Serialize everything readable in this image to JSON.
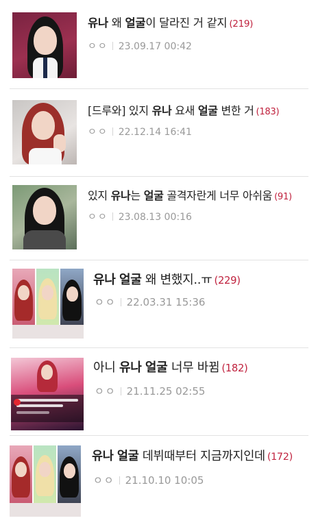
{
  "posts": [
    {
      "title_parts": [
        {
          "text": "유나",
          "bold": true
        },
        {
          "text": " 왜 ",
          "bold": false
        },
        {
          "text": "얼굴",
          "bold": true
        },
        {
          "text": "이 달라진 거 같지",
          "bold": false
        }
      ],
      "count": "(219)",
      "author": "ㅇㅇ",
      "date": "23.09.17 00:42"
    },
    {
      "title_parts": [
        {
          "text": "[드루와] 있지 ",
          "bold": false
        },
        {
          "text": "유나",
          "bold": true
        },
        {
          "text": " 요새 ",
          "bold": false
        },
        {
          "text": "얼굴",
          "bold": true
        },
        {
          "text": " 변한 거",
          "bold": false
        }
      ],
      "count": "(183)",
      "author": "ㅇㅇ",
      "date": "22.12.14 16:41"
    },
    {
      "title_parts": [
        {
          "text": "있지 ",
          "bold": false
        },
        {
          "text": "유나",
          "bold": true
        },
        {
          "text": "는 ",
          "bold": false
        },
        {
          "text": "얼굴",
          "bold": true
        },
        {
          "text": " 골격자란게 너무 아쉬움",
          "bold": false
        }
      ],
      "count": "(91)",
      "author": "ㅇㅇ",
      "date": "23.08.13 00:16"
    },
    {
      "title_parts": [
        {
          "text": "유나",
          "bold": true
        },
        {
          "text": " ",
          "bold": false
        },
        {
          "text": "얼굴",
          "bold": true
        },
        {
          "text": " 왜 변했지..ㅠ",
          "bold": false
        }
      ],
      "count": "(229)",
      "author": "ㅇㅇ",
      "date": "22.03.31 15:36"
    },
    {
      "title_parts": [
        {
          "text": "아니 ",
          "bold": false
        },
        {
          "text": "유나",
          "bold": true
        },
        {
          "text": " ",
          "bold": false
        },
        {
          "text": "얼굴",
          "bold": true
        },
        {
          "text": " 너무 바뀜",
          "bold": false
        }
      ],
      "count": "(182)",
      "author": "ㅇㅇ",
      "date": "21.11.25 02:55"
    },
    {
      "title_parts": [
        {
          "text": "유나",
          "bold": true
        },
        {
          "text": " ",
          "bold": false
        },
        {
          "text": "얼굴",
          "bold": true
        },
        {
          "text": " 데뷔때부터 지금까지인데",
          "bold": false
        }
      ],
      "count": "(172)",
      "author": "ㅇㅇ",
      "date": "21.10.10 10:05"
    }
  ],
  "colors": {
    "count": "#c0233f",
    "meta": "#999999",
    "divider": "#e2e2e2"
  }
}
